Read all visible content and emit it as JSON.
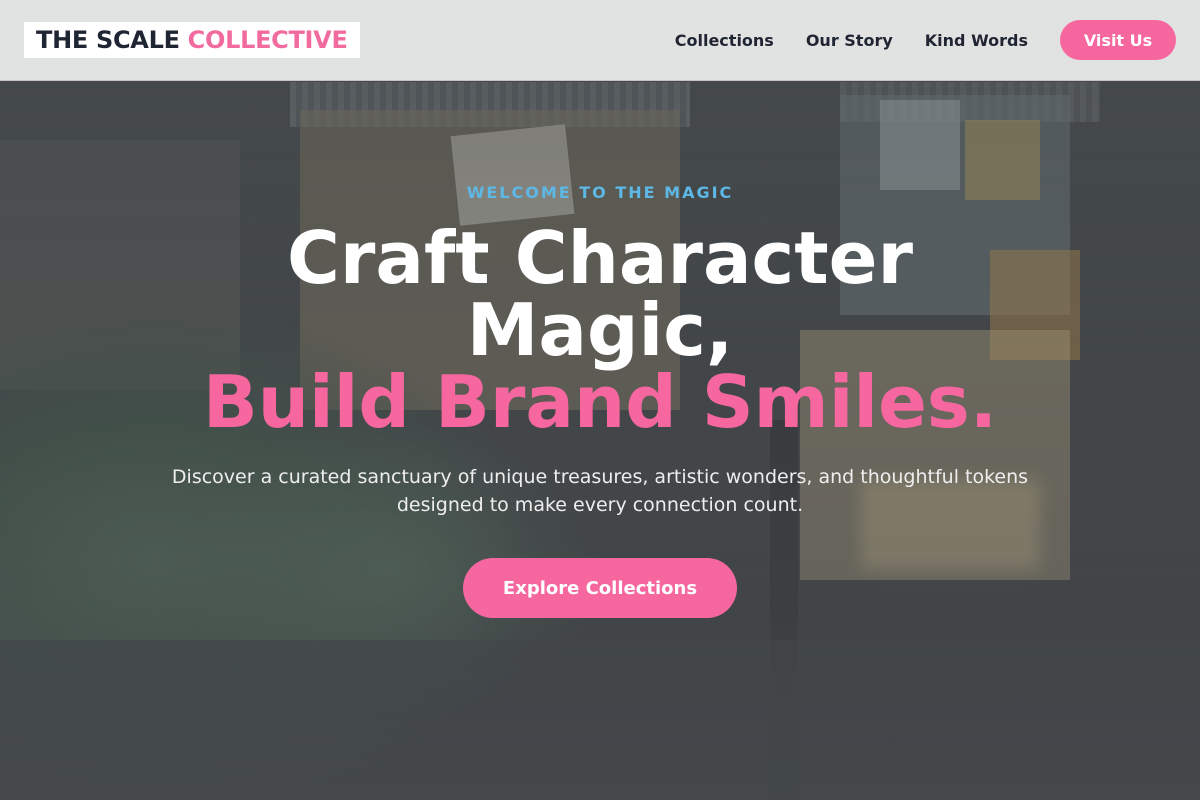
{
  "brand": {
    "name_dark": "THE SCALE",
    "name_pink": "COLLECTIVE"
  },
  "nav": {
    "links": [
      "Collections",
      "Our Story",
      "Kind Words"
    ],
    "cta_label": "Visit Us"
  },
  "hero": {
    "eyebrow": "WELCOME TO THE MAGIC",
    "headline_line1": "Craft Character Magic,",
    "headline_line2": "Build Brand Smiles.",
    "subtext": "Discover a curated sanctuary of unique treasures, artistic wonders, and thoughtful tokens designed to make every connection count.",
    "cta_label": "Explore Collections"
  },
  "colors": {
    "accent_pink": "#f6679f",
    "eyebrow_blue": "#5db8e6",
    "navy": "#1f2533"
  }
}
